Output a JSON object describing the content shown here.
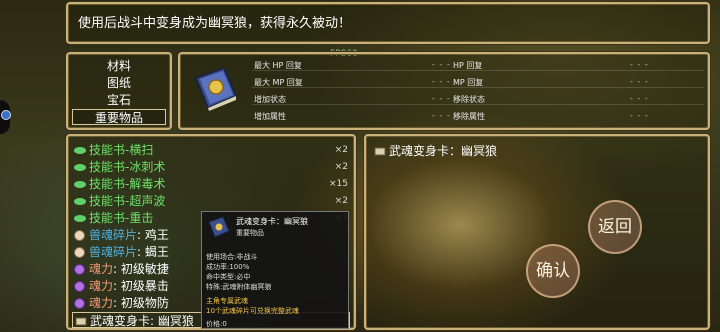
{
  "description": "使用后战斗中变身成为幽冥狼，获得永久被动！",
  "fps": "FPS60",
  "categories": [
    {
      "label": "材料"
    },
    {
      "label": "图纸"
    },
    {
      "label": "宝石"
    },
    {
      "label": "重要物品"
    }
  ],
  "detail": {
    "stats_left": [
      {
        "label": "最大 HP 回复",
        "value": "- - -"
      },
      {
        "label": "最大 MP 回复",
        "value": "- - -"
      },
      {
        "label": "增加状态",
        "value": "- - -"
      },
      {
        "label": "增加属性",
        "value": "- - -"
      }
    ],
    "stats_right": [
      {
        "label": "HP 回复",
        "value": "- - -"
      },
      {
        "label": "MP 回复",
        "value": "- - -"
      },
      {
        "label": "移除状态",
        "value": "- - -"
      },
      {
        "label": "移除属性",
        "value": "- - -"
      }
    ]
  },
  "items": [
    {
      "prefix": "技能书",
      "name": "-横扫",
      "count": "×2"
    },
    {
      "prefix": "技能书",
      "name": "-冰刺术",
      "count": "×2"
    },
    {
      "prefix": "技能书",
      "name": "-解毒术",
      "count": "×15"
    },
    {
      "prefix": "技能书",
      "name": "-超声波",
      "count": "×2"
    },
    {
      "prefix": "技能书",
      "name": "-重击",
      "count": "×1"
    },
    {
      "prefix": "兽魂碎片",
      "name": ": 鸡王",
      "count": ""
    },
    {
      "prefix": "兽魂碎片",
      "name": ": 蝎王",
      "count": ""
    },
    {
      "prefix": "魂力",
      "name": ": 初级敏捷",
      "count": ""
    },
    {
      "prefix": "魂力",
      "name": ": 初级暴击",
      "count": ""
    },
    {
      "prefix": "魂力",
      "name": ": 初级物防",
      "count": ""
    },
    {
      "prefix": "武魂变身卡",
      "name": ": 幽冥狼",
      "count": ""
    }
  ],
  "selected_item": "武魂变身卡：幽冥狼",
  "buttons": {
    "back": "返回",
    "confirm": "确认"
  },
  "tooltip": {
    "title": "武魂变身卡：幽冥狼",
    "type": "重要物品",
    "lines": [
      "使用场合:非战斗",
      "成功率:100%",
      "命中类型:必中",
      "特殊:武魂附体幽冥狼"
    ],
    "bonus": [
      "主角专属武魂",
      "10个武魂碎片可兑换完整武魂"
    ],
    "price": "价格:0"
  },
  "colors": {
    "skillbook": "#6ee06a",
    "beast": "#4fb0e0",
    "soul": "#f29a7a",
    "accent": "#c9b27a"
  }
}
